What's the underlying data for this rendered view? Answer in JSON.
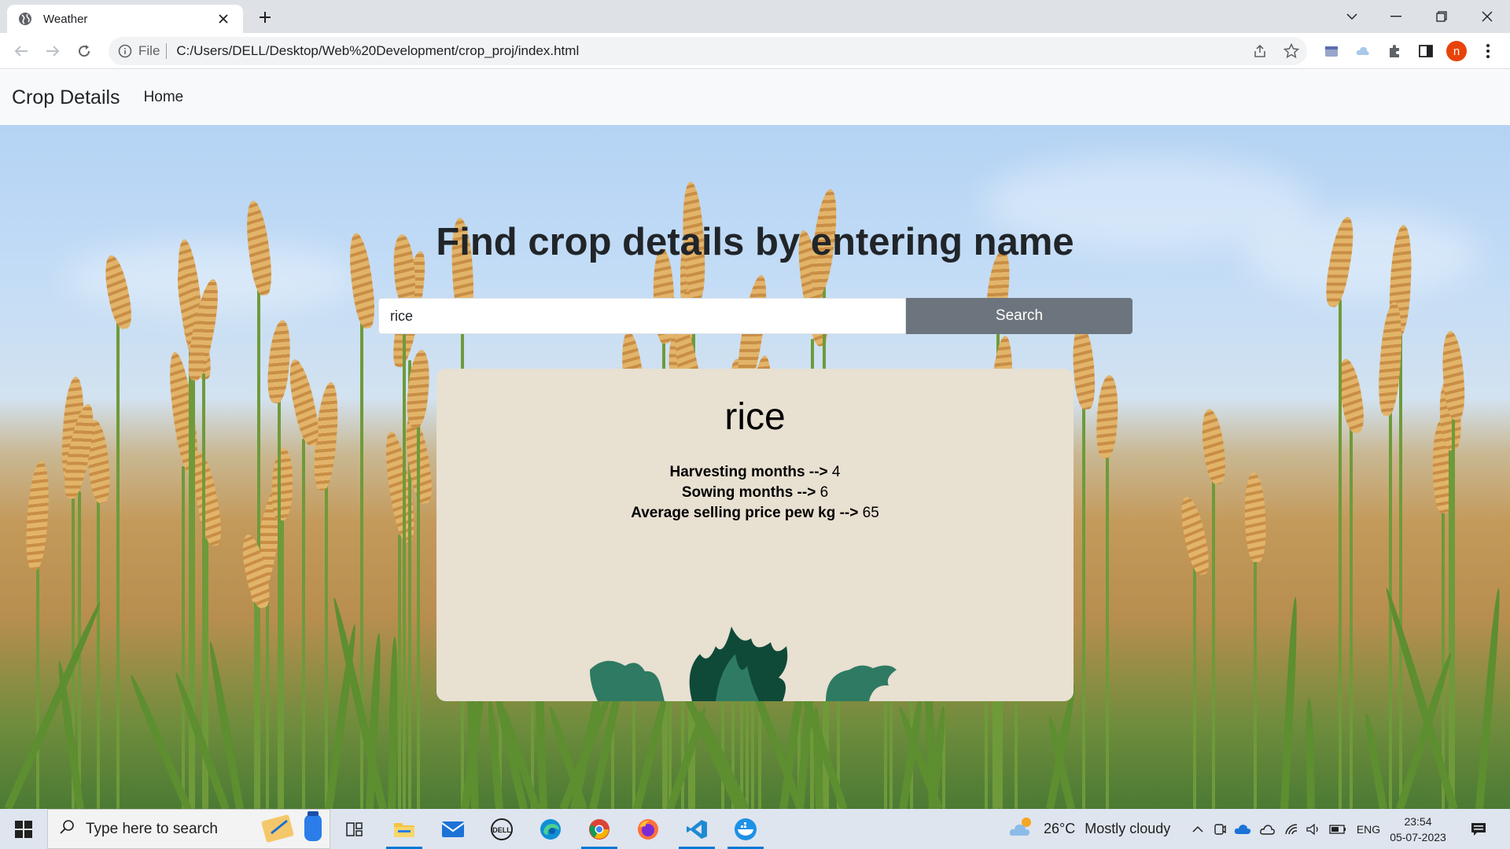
{
  "browser": {
    "tab_title": "Weather",
    "omnibox_scheme": "File",
    "url": "C:/Users/DELL/Desktop/Web%20Development/crop_proj/index.html",
    "profile_initial": "n"
  },
  "navbar": {
    "brand": "Crop Details",
    "links": [
      "Home"
    ]
  },
  "main": {
    "heading": "Find crop details by entering name",
    "search": {
      "value": "rice",
      "button_label": "Search"
    }
  },
  "result": {
    "crop_name": "rice",
    "fields": [
      {
        "label": "Harvesting months -->",
        "value": "4"
      },
      {
        "label": "Sowing months -->",
        "value": "6"
      },
      {
        "label": "Average selling price pew kg -->",
        "value": "65"
      }
    ]
  },
  "taskbar": {
    "search_placeholder": "Type here to search",
    "weather_temp": "26°C",
    "weather_text": "Mostly cloudy",
    "language": "ENG",
    "time": "23:54",
    "date": "05-07-2023"
  },
  "colors": {
    "search_button": "#6c757d",
    "card_bg": "#e8e0d1",
    "navbar_bg": "#f8f9fa"
  }
}
